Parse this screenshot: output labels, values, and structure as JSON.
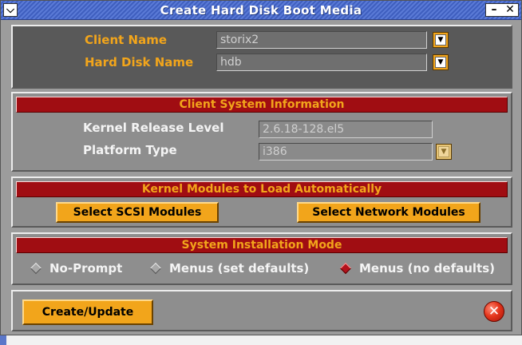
{
  "window": {
    "title": "Create Hard Disk Boot Media",
    "menu_glyph": "❯",
    "minimize_glyph": "‗",
    "close_glyph": "✖"
  },
  "client": {
    "client_name_label": "Client Name",
    "client_name_value": "storix2",
    "hard_disk_label": "Hard Disk Name",
    "hard_disk_value": "hdb",
    "dropdown_glyph": "⌄"
  },
  "system_info": {
    "header": "Client System Information",
    "kernel_label": "Kernel Release Level",
    "kernel_value": "2.6.18-128.el5",
    "platform_label": "Platform Type",
    "platform_value": "i386"
  },
  "modules": {
    "header": "Kernel Modules to Load Automatically",
    "scsi_button": "Select SCSI Modules",
    "network_button": "Select Network Modules"
  },
  "install_mode": {
    "header": "System Installation Mode",
    "options": [
      {
        "label": "No-Prompt",
        "selected": false
      },
      {
        "label": "Menus (set defaults)",
        "selected": false
      },
      {
        "label": "Menus (no defaults)",
        "selected": true
      }
    ]
  },
  "footer": {
    "create_button": "Create/Update",
    "close_glyph": "✕"
  },
  "colors": {
    "accent_orange": "#f2a51b",
    "header_red": "#a00d12",
    "title_blue": "#4a6bcf"
  }
}
